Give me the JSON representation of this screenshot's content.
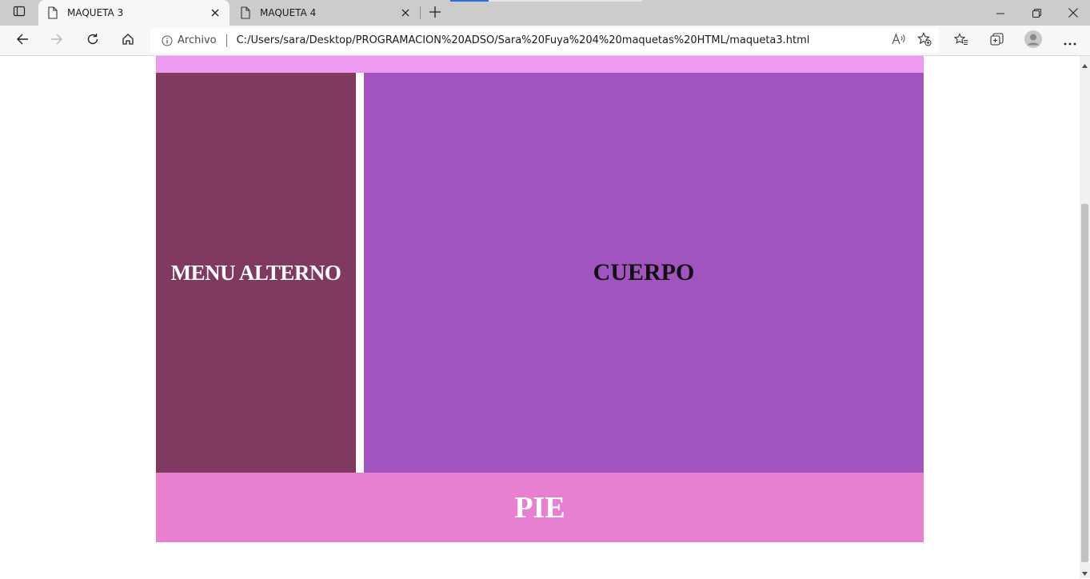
{
  "browser": {
    "tabs": [
      {
        "title": "MAQUETA 3",
        "active": true
      },
      {
        "title": "MAQUETA 4",
        "active": false
      }
    ],
    "address": {
      "site_info_label": "Archivo",
      "url": "C:/Users/sara/Desktop/PROGRAMACION%20ADSO/Sara%20Fuya%204%20maquetas%20HTML/maqueta3.html"
    },
    "icons": {
      "tab_actions": "tab-actions-icon",
      "page": "page-icon",
      "close": "close-icon",
      "new_tab": "plus-icon",
      "back": "back-arrow-icon",
      "forward": "forward-arrow-icon",
      "refresh": "refresh-icon",
      "home": "home-icon",
      "info": "info-icon",
      "read_aloud": "read-aloud-icon",
      "add_favorite": "add-favorite-icon",
      "favorites": "favorites-icon",
      "collections": "collections-icon",
      "profile": "profile-icon",
      "more": "more-icon"
    }
  },
  "page": {
    "menu_alterno": "MENU ALTERNO",
    "cuerpo": "CUERPO",
    "pie": "PIE"
  },
  "colors": {
    "header": "#ee99f2",
    "menu_alterno": "#803a60",
    "cuerpo": "#a154bf",
    "pie": "#e87fd0"
  }
}
